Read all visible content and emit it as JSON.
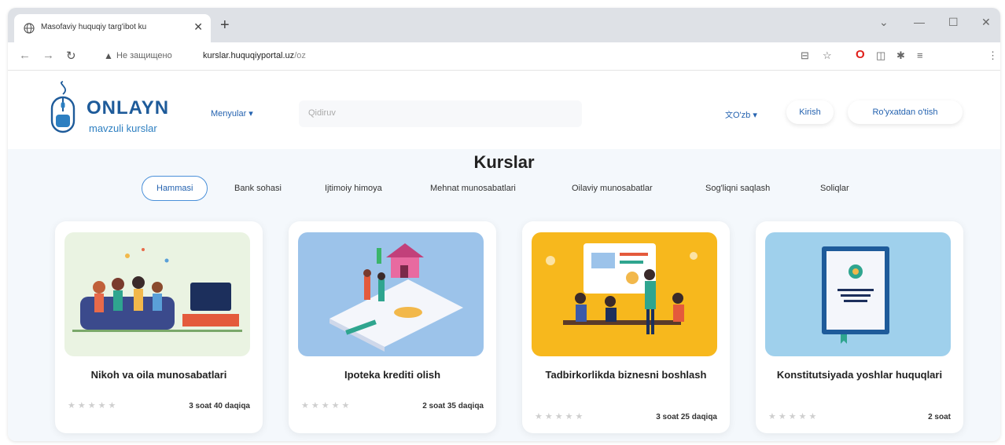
{
  "browser": {
    "tab_title": "Masofaviy huquqiy targ'ibot ku",
    "new_tab_label": "+",
    "security_label": "Не защищено",
    "url_host": "kurslar.huquqiyportal.uz",
    "url_path": "/oz",
    "window_controls": [
      "⌄",
      "—",
      "☐",
      "✕"
    ]
  },
  "header": {
    "logo_title": "ONLAYN",
    "logo_subtitle": "mavzuli kurslar",
    "menu_label": "Menyular ▾",
    "search_placeholder": "Qidiruv",
    "language_label": "O'zb ▾",
    "login_label": "Kirish",
    "register_label": "Ro'yxatdan o'tish"
  },
  "main": {
    "title": "Kurslar",
    "categories": [
      "Hammasi",
      "Bank sohasi",
      "Ijtimoiy himoya",
      "Mehnat munosabatlari",
      "Oilaviy munosabatlar",
      "Sog'liqni saqlash",
      "Soliqlar"
    ],
    "active_category": "Hammasi",
    "courses": [
      {
        "title": "Nikoh va oila munosabatlari",
        "duration": "3 soat 40 daqiqa",
        "rating_stars": "★★★★★",
        "image_color": "#eaf3e2",
        "image_icon": "family-sofa-tv-illustration"
      },
      {
        "title": "Ipoteka krediti olish",
        "duration": "2 soat 35 daqiqa",
        "rating_stars": "★★★★★",
        "image_color": "#9cc3ea",
        "image_icon": "house-mortgage-illustration"
      },
      {
        "title": "Tadbirkorlikda biznesni boshlash",
        "duration": "3 soat 25 daqiqa",
        "rating_stars": "★★★★★",
        "image_color": "#f7b81d",
        "image_icon": "business-meeting-illustration"
      },
      {
        "title": "Konstitutsiyada yoshlar huquqlari",
        "duration": "2 soat",
        "rating_stars": "★★★★★",
        "image_color": "#9fd0ec",
        "image_icon": "constitution-book-illustration"
      }
    ]
  }
}
